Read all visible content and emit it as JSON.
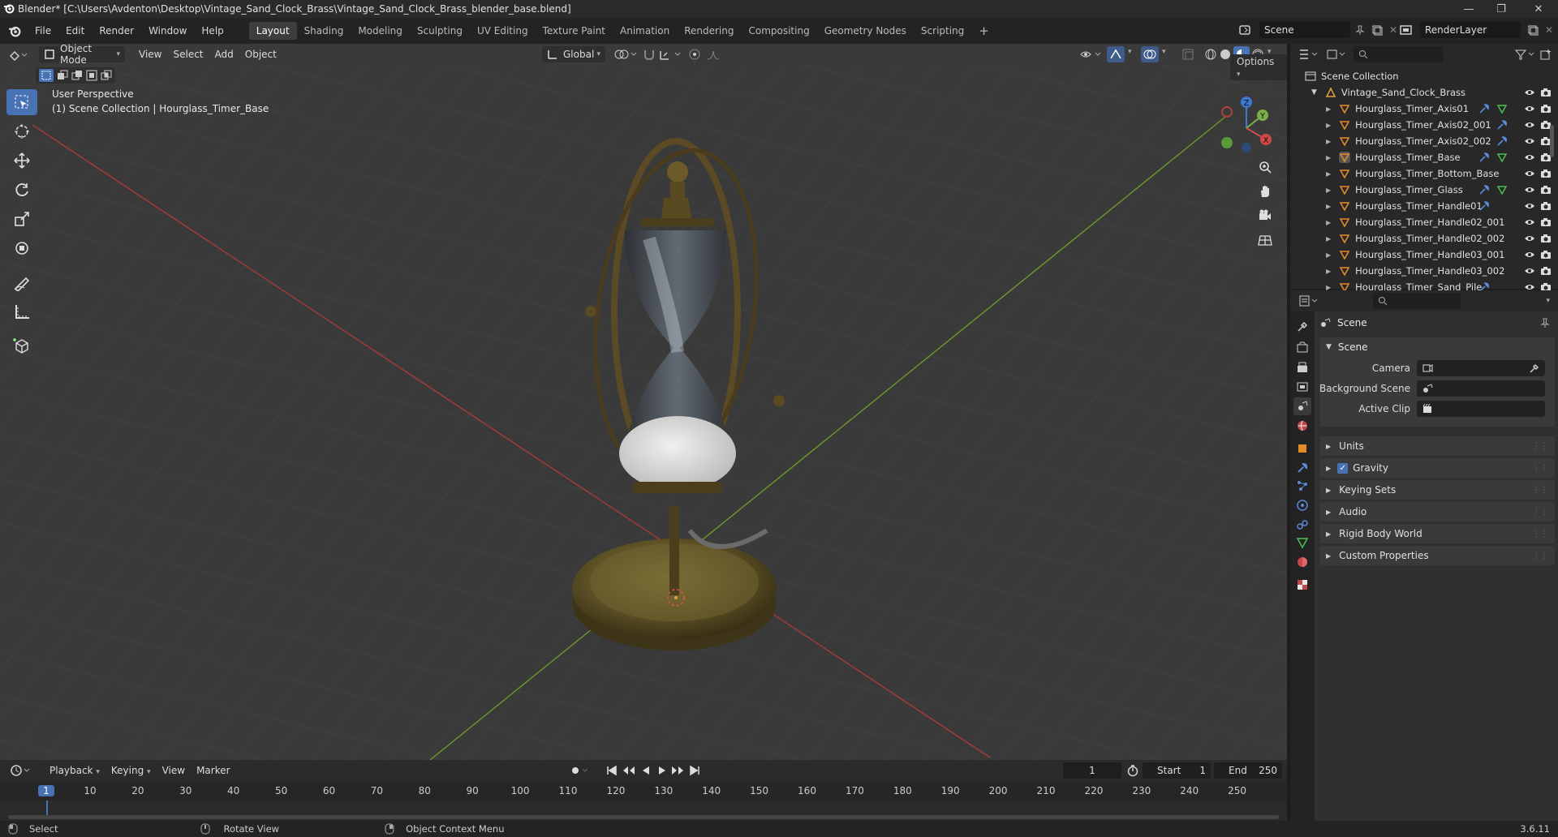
{
  "window": {
    "title": "Blender* [C:\\Users\\Avdenton\\Desktop\\Vintage_Sand_Clock_Brass\\Vintage_Sand_Clock_Brass_blender_base.blend]",
    "minimize_glyph": "—",
    "maximize_glyph": "❐",
    "close_glyph": "✕"
  },
  "menu": {
    "items": [
      "File",
      "Edit",
      "Render",
      "Window",
      "Help"
    ]
  },
  "workspaces": {
    "tabs": [
      "Layout",
      "Shading",
      "Modeling",
      "Sculpting",
      "UV Editing",
      "Texture Paint",
      "Animation",
      "Rendering",
      "Compositing",
      "Geometry Nodes",
      "Scripting"
    ],
    "active": "Layout",
    "add_glyph": "+"
  },
  "scene_selector": {
    "value": "Scene"
  },
  "view_layer_selector": {
    "value": "RenderLayer"
  },
  "viewport": {
    "mode": "Object Mode",
    "menus": [
      "View",
      "Select",
      "Add",
      "Object"
    ],
    "transform_orientation": "Global",
    "options_label": "Options",
    "overlay_line1": "User Perspective",
    "overlay_line2": "(1) Scene Collection | Hourglass_Timer_Base",
    "gizmo_labels": {
      "x": "X",
      "y": "Y",
      "z": "Z"
    },
    "tools": [
      "select-box",
      "cursor",
      "move",
      "rotate",
      "scale",
      "transform",
      "annotate",
      "measure",
      "add-cube"
    ]
  },
  "outliner": {
    "root": "Scene Collection",
    "collection": "Vintage_Sand_Clock_Brass",
    "objects": [
      "Hourglass_Timer_Axis01",
      "Hourglass_Timer_Axis02_001",
      "Hourglass_Timer_Axis02_002",
      "Hourglass_Timer_Base",
      "Hourglass_Timer_Bottom_Base",
      "Hourglass_Timer_Glass",
      "Hourglass_Timer_Handle01",
      "Hourglass_Timer_Handle02_001",
      "Hourglass_Timer_Handle02_002",
      "Hourglass_Timer_Handle03_001",
      "Hourglass_Timer_Handle03_002",
      "Hourglass_Timer_Sand_Pile"
    ],
    "active_object": "Hourglass_Timer_Base"
  },
  "properties": {
    "context_title": "Scene",
    "panel_scene": "Scene",
    "camera_label": "Camera",
    "background_scene_label": "Background Scene",
    "active_clip_label": "Active Clip",
    "collapsed_panels": [
      "Units",
      "Gravity",
      "Keying Sets",
      "Audio",
      "Rigid Body World",
      "Custom Properties"
    ],
    "gravity_checked": true
  },
  "timeline": {
    "menus": [
      "Playback",
      "Keying",
      "View",
      "Marker"
    ],
    "current_frame": "1",
    "start_label": "Start",
    "start_value": "1",
    "end_label": "End",
    "end_value": "250",
    "ruler": [
      "1",
      "10",
      "20",
      "30",
      "40",
      "50",
      "60",
      "70",
      "80",
      "90",
      "100",
      "110",
      "120",
      "130",
      "140",
      "150",
      "160",
      "170",
      "180",
      "190",
      "200",
      "210",
      "220",
      "230",
      "240",
      "250"
    ]
  },
  "statusbar": {
    "select": "Select",
    "rotate": "Rotate View",
    "context": "Object Context Menu",
    "version": "3.6.11"
  },
  "colors": {
    "accent": "#4772b3",
    "x_axis": "#a83a3a",
    "y_axis": "#6a9a2a",
    "object_orange": "#e08a2a"
  }
}
